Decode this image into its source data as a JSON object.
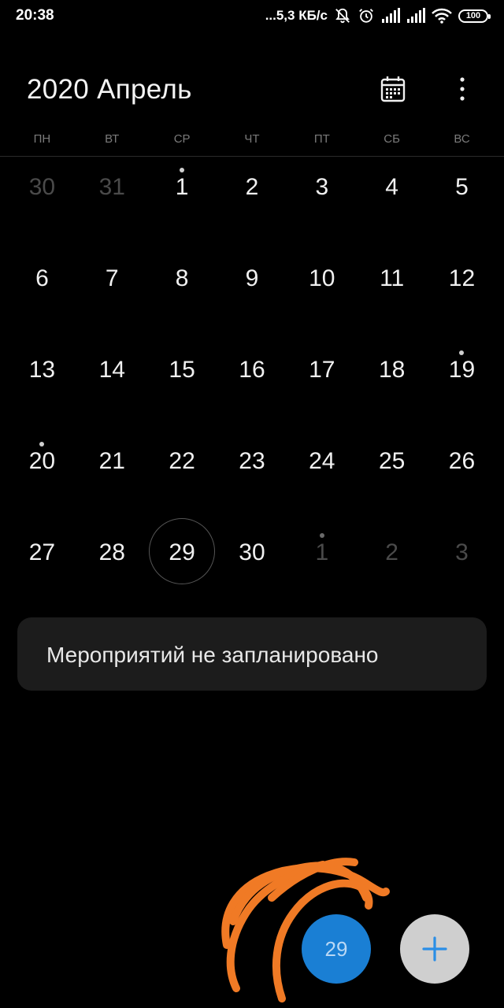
{
  "status_bar": {
    "time": "20:38",
    "network_speed": "...5,3 КБ/с",
    "battery_level": "100",
    "icons": [
      "bell-muted-icon",
      "alarm-icon",
      "signal-icon",
      "signal-icon",
      "wifi-icon",
      "battery-icon"
    ]
  },
  "header": {
    "title": "2020 Апрель",
    "icons": [
      "calendar-icon",
      "more-vert-icon"
    ]
  },
  "weekdays": [
    "ПН",
    "ВТ",
    "СР",
    "ЧТ",
    "ПТ",
    "СБ",
    "ВС"
  ],
  "weeks": [
    [
      {
        "day": "30",
        "current_month": false,
        "event": false
      },
      {
        "day": "31",
        "current_month": false,
        "event": false
      },
      {
        "day": "1",
        "current_month": true,
        "event": true
      },
      {
        "day": "2",
        "current_month": true,
        "event": false
      },
      {
        "day": "3",
        "current_month": true,
        "event": false
      },
      {
        "day": "4",
        "current_month": true,
        "event": false
      },
      {
        "day": "5",
        "current_month": true,
        "event": false
      }
    ],
    [
      {
        "day": "6",
        "current_month": true,
        "event": false
      },
      {
        "day": "7",
        "current_month": true,
        "event": false
      },
      {
        "day": "8",
        "current_month": true,
        "event": false
      },
      {
        "day": "9",
        "current_month": true,
        "event": false
      },
      {
        "day": "10",
        "current_month": true,
        "event": false
      },
      {
        "day": "11",
        "current_month": true,
        "event": false
      },
      {
        "day": "12",
        "current_month": true,
        "event": false
      }
    ],
    [
      {
        "day": "13",
        "current_month": true,
        "event": false
      },
      {
        "day": "14",
        "current_month": true,
        "event": false
      },
      {
        "day": "15",
        "current_month": true,
        "event": false
      },
      {
        "day": "16",
        "current_month": true,
        "event": false
      },
      {
        "day": "17",
        "current_month": true,
        "event": false
      },
      {
        "day": "18",
        "current_month": true,
        "event": false
      },
      {
        "day": "19",
        "current_month": true,
        "event": true
      }
    ],
    [
      {
        "day": "20",
        "current_month": true,
        "event": true
      },
      {
        "day": "21",
        "current_month": true,
        "event": false
      },
      {
        "day": "22",
        "current_month": true,
        "event": false
      },
      {
        "day": "23",
        "current_month": true,
        "event": false
      },
      {
        "day": "24",
        "current_month": true,
        "event": false
      },
      {
        "day": "25",
        "current_month": true,
        "event": false
      },
      {
        "day": "26",
        "current_month": true,
        "event": false
      }
    ],
    [
      {
        "day": "27",
        "current_month": true,
        "event": false
      },
      {
        "day": "28",
        "current_month": true,
        "event": false
      },
      {
        "day": "29",
        "current_month": true,
        "event": false,
        "selected": true
      },
      {
        "day": "30",
        "current_month": true,
        "event": false
      },
      {
        "day": "1",
        "current_month": false,
        "event": true
      },
      {
        "day": "2",
        "current_month": false,
        "event": false
      },
      {
        "day": "3",
        "current_month": false,
        "event": false
      }
    ]
  ],
  "events_card": {
    "text": "Мероприятий не запланировано"
  },
  "fab": {
    "today_label": "29",
    "add_icon": "plus-icon",
    "today_color": "#1a7fd4",
    "add_color": "#cfcfcf",
    "accent": "#2a8ee6"
  },
  "annotation": {
    "color": "#f07a25",
    "kind": "hand-drawn scribble"
  }
}
